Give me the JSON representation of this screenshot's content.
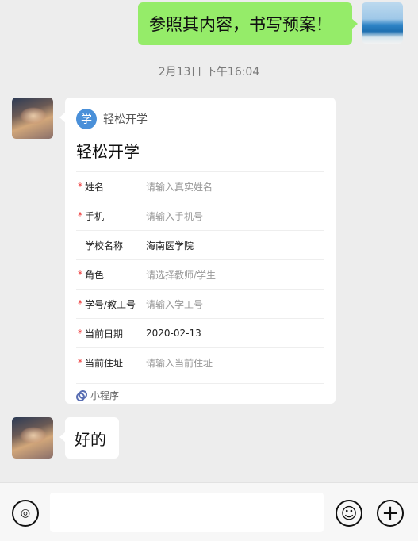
{
  "messages": {
    "outgoing_1": {
      "text": "参照其内容，书写预案！"
    },
    "timestamp": "2月13日 下午16:04",
    "card": {
      "app_logo_char": "学",
      "app_name": "轻松开学",
      "title": "轻松开学",
      "fields": [
        {
          "required_mark": "*",
          "label": "姓名",
          "value": "请输入真实姓名",
          "filled": false
        },
        {
          "required_mark": "*",
          "label": "手机",
          "value": "请输入手机号",
          "filled": false
        },
        {
          "required_mark": "",
          "label": "学校名称",
          "value": "海南医学院",
          "filled": true
        },
        {
          "required_mark": "*",
          "label": "角色",
          "value": "请选择教师/学生",
          "filled": false
        },
        {
          "required_mark": "*",
          "label": "学号/教工号",
          "value": "请输入学工号",
          "filled": false
        },
        {
          "required_mark": "*",
          "label": "当前日期",
          "value": "2020-02-13",
          "filled": true
        },
        {
          "required_mark": "*",
          "label": "当前住址",
          "value": "请输入当前住址",
          "filled": false
        }
      ],
      "footer_label": "小程序"
    },
    "incoming_reply": {
      "text": "好的"
    }
  },
  "input_bar": {
    "voice_icon": "voice-icon",
    "emoji_icon": "emoji-icon",
    "plus_icon": "plus-icon",
    "text_value": ""
  },
  "colors": {
    "outgoing_bubble": "#95ec69",
    "background": "#ededed",
    "required": "#e33333",
    "mini_program_icon": "#5a6fb3"
  }
}
